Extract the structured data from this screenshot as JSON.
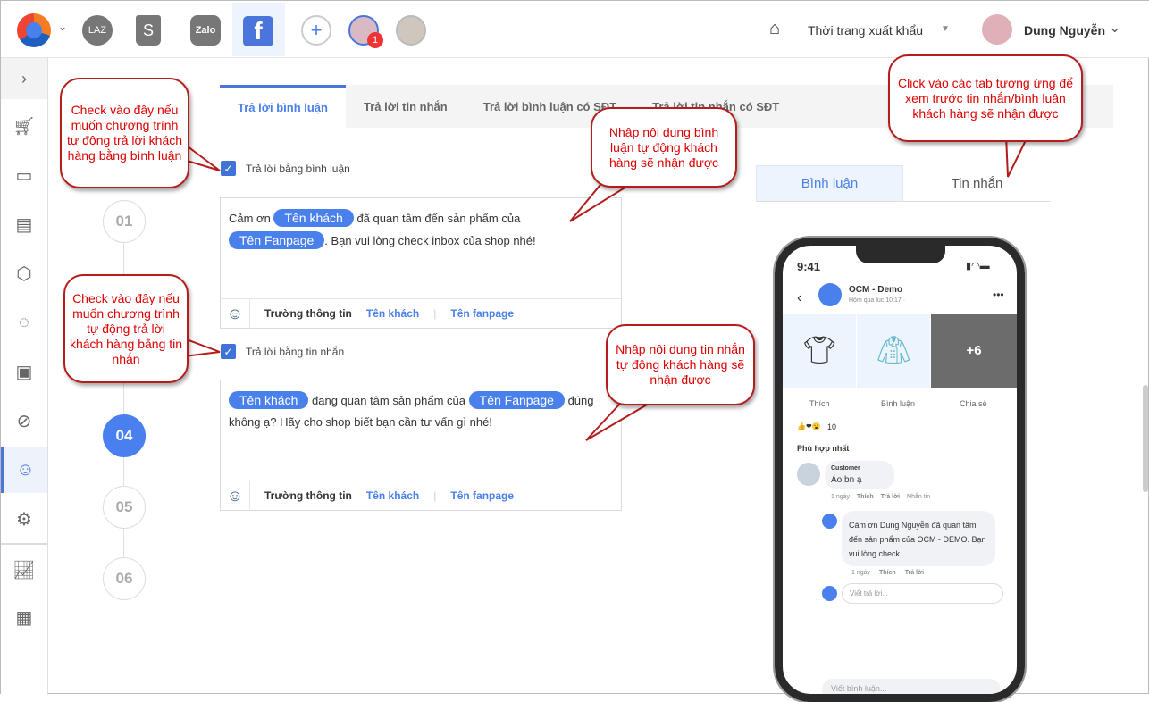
{
  "topbar": {
    "channels": [
      "LAZ",
      "S",
      "Zalo",
      "f"
    ],
    "notification_count": "1",
    "shop_name": "Thời trang xuất khẩu",
    "user_name": "Dung Nguyễn"
  },
  "sidebar": {
    "items": [
      "expand",
      "cart",
      "video",
      "document",
      "box",
      "messenger",
      "card",
      "block",
      "bot",
      "settings",
      "chart",
      "report"
    ]
  },
  "steps": [
    "01",
    "04",
    "05",
    "06"
  ],
  "tabs": [
    "Trả lời bình luận",
    "Trả lời tin nhắn",
    "Trả lời bình luận có SĐT",
    "Trả lời tin nhắn có SĐT"
  ],
  "comment": {
    "checkbox_label": "Trả lời bằng bình luận",
    "text_1": "Cảm ơn",
    "pill_1": "Tên khách",
    "text_2": "đã quan tâm đến sản phẩm của",
    "pill_2": "Tên Fanpage",
    "text_3": ". Bạn vui lòng check inbox của shop nhé!"
  },
  "message": {
    "checkbox_label": "Trả lời bằng tin nhắn",
    "pill_1": "Tên khách",
    "text_1": "đang quan tâm sản phẩm của",
    "pill_2": "Tên Fanpage",
    "text_2": "đúng không ạ? Hãy cho shop biết bạn cần tư vấn gì nhé!"
  },
  "footer": {
    "field_label": "Trường thông tin",
    "link_customer": "Tên khách",
    "link_fanpage": "Tên fanpage"
  },
  "preview_tabs": [
    "Bình luận",
    "Tin nhắn"
  ],
  "phone": {
    "time": "9:41",
    "page": "OCM - Demo",
    "post_time": "Hôm qua lúc 10:17 ·",
    "more_count": "+6",
    "like": "Thích",
    "comment": "Bình luận",
    "share": "Chia sẻ",
    "reactions": "10",
    "sort": "Phù hợp nhất",
    "customer": "Customer",
    "customer_msg": "Áo bn ạ",
    "age": "1 ngày",
    "like_small": "Thích",
    "reply": "Trả lời",
    "message_link": "Nhắn tin",
    "reply_msg": "Cảm ơn Dung Nguyễn đã quan tâm đến sản phẩm của OCM - DEMO. Bạn vui lòng check...",
    "reply_placeholder": "Viết trả lời...",
    "comment_placeholder": "Viết bình luận..."
  },
  "callouts": [
    "Check vào đây nếu muốn chương trình tự động trả lời khách hàng bằng bình luận",
    "Check vào đây nếu muốn chương trình tự động trả lời khách hàng bằng tin nhắn",
    "Nhập nội dung bình luận tự động khách hàng sẽ nhận được",
    "Nhập nội dung tin nhắn tự động khách hàng sẽ nhận được",
    "Click vào các tab tương ứng để xem trước tin nhắn/bình luận khách hàng sẽ nhận được"
  ]
}
